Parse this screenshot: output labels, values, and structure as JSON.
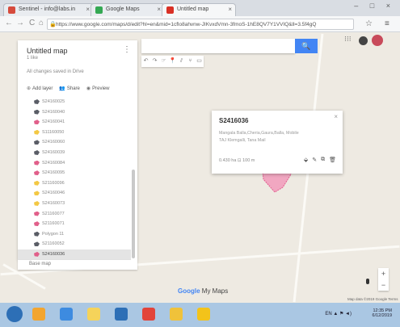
{
  "browser": {
    "tabs": [
      {
        "label": "Sentinel - info@labs.in",
        "favicon_color": "#d64b3c",
        "active": false
      },
      {
        "label": "Google Maps",
        "favicon_color": "#34a853",
        "active": false
      },
      {
        "label": "Untitled map",
        "favicon_color": "#d93025",
        "active": true
      }
    ],
    "url": "https://www.google.com/maps/d/edit?hl=en&mid=1cflo8ahvnw-JIKvxdVmn-3fmoS-1hE8QV7Y1VVIQ&ll=3.5f4gQ",
    "window_controls": "– □ ×"
  },
  "panel": {
    "title": "Untitled map",
    "subtitle": "1 like",
    "description": "All changes saved in Drive",
    "menu_icon": "⋮",
    "actions": [
      {
        "icon": "⊕",
        "label": "Add layer"
      },
      {
        "icon": "👥",
        "label": "Share"
      },
      {
        "icon": "◉",
        "label": "Preview"
      }
    ],
    "layers": [
      {
        "label": "S24160025",
        "color": "#5a5d66"
      },
      {
        "label": "S24160040",
        "color": "#5a5d66"
      },
      {
        "label": "S24160041",
        "color": "#e15f8a"
      },
      {
        "label": "S11160050",
        "color": "#f3c844"
      },
      {
        "label": "S24160060",
        "color": "#5a5d66"
      },
      {
        "label": "S24160039",
        "color": "#5a5d66"
      },
      {
        "label": "S24160084",
        "color": "#e15f8a"
      },
      {
        "label": "S24160095",
        "color": "#e15f8a"
      },
      {
        "label": "S21160096",
        "color": "#f3c844"
      },
      {
        "label": "S24160046",
        "color": "#f3c844"
      },
      {
        "label": "S24160073",
        "color": "#f3c844"
      },
      {
        "label": "S21160077",
        "color": "#e15f8a"
      },
      {
        "label": "S21160071",
        "color": "#e15f8a"
      },
      {
        "label": "Polygon 11",
        "color": "#5a5d66"
      },
      {
        "label": "S21160052",
        "color": "#5a5d66"
      },
      {
        "label": "S24160036",
        "color": "#e15f8a",
        "selected": true
      }
    ],
    "basemap_label": "Base map"
  },
  "search": {
    "placeholder": "",
    "button_icon": "🔍"
  },
  "toolbar": [
    "↶",
    "↷",
    "☞",
    "📍",
    "⫽",
    "⑂",
    "▭"
  ],
  "topbar": {
    "apps_icon": "⁝⁝⁝"
  },
  "card": {
    "title": "S2416036",
    "close": "×",
    "lines": [
      "Mangala Balla,Cheria,Gaura,Balla, Mobile",
      "TAJ Klemgalli, Tana Mail"
    ],
    "measure": "0.430 ha  ⊡ 100 m",
    "icons": [
      "⬙",
      "✎",
      "⧉",
      "🗑"
    ]
  },
  "zoom": {
    "in": "+",
    "out": "−"
  },
  "footer": {
    "brand": "Google",
    "product": "My Maps",
    "attribution": "Map data ©2019 Google  Terms"
  },
  "taskbar": {
    "clock_time": "12:35 PM",
    "clock_date": "6/12/2019",
    "tray": "EN ▲ ⚑ ◄)",
    "icons": [
      "#f2a530",
      "#3d8be0",
      "#f5d35a",
      "#2d6fb6",
      "#e2443a",
      "#f0c23a",
      "#f3c31a"
    ]
  }
}
